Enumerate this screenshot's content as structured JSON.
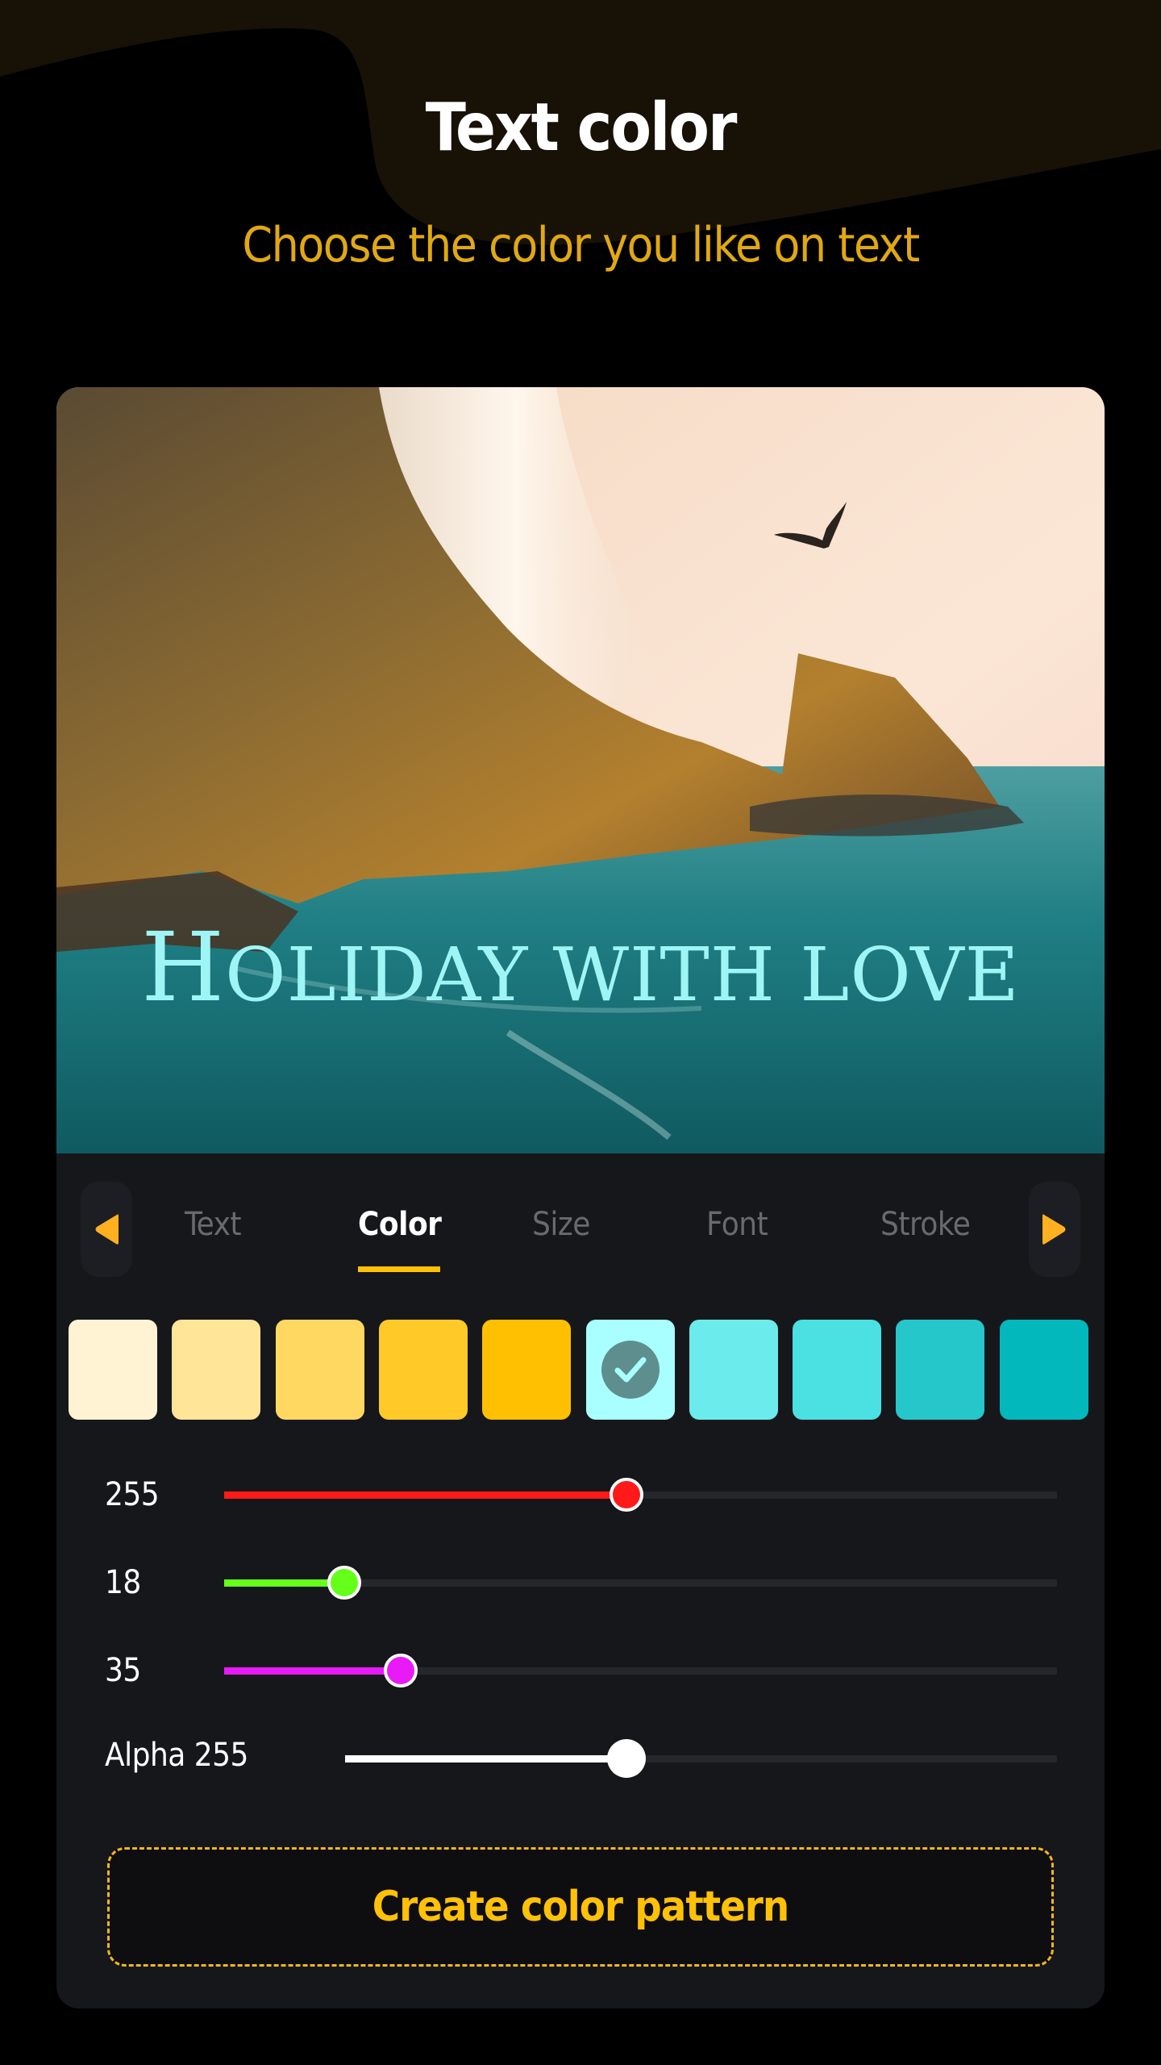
{
  "header": {
    "title": "Text color",
    "subtitle": "Choose the color you like on text"
  },
  "preview": {
    "overlay_text_first": "H",
    "overlay_text_rest": "OLIDAY WITH LOVE",
    "overlay_text_color": "#9FF5F5",
    "image_description": "cliff with waterfall, seagull and turquoise sea"
  },
  "tabs": {
    "prev_icon": "triangle-left-icon",
    "next_icon": "triangle-right-icon",
    "items": [
      {
        "label": "Text",
        "active": false
      },
      {
        "label": "Color",
        "active": true
      },
      {
        "label": "Size",
        "active": false
      },
      {
        "label": "Font",
        "active": false
      },
      {
        "label": "Stroke",
        "active": false
      }
    ]
  },
  "swatches": [
    {
      "color": "#FFF3D3",
      "selected": false
    },
    {
      "color": "#FFE597",
      "selected": false
    },
    {
      "color": "#FFD862",
      "selected": false
    },
    {
      "color": "#FFCA28",
      "selected": false
    },
    {
      "color": "#FFC002",
      "selected": false
    },
    {
      "color": "#A9FFFF",
      "selected": true
    },
    {
      "color": "#6BEBEB",
      "selected": false
    },
    {
      "color": "#4BE0E2",
      "selected": false
    },
    {
      "color": "#25C7CB",
      "selected": false
    },
    {
      "color": "#02B8BD",
      "selected": false
    }
  ],
  "sliders": [
    {
      "name": "red",
      "label": "255",
      "value_fraction": 0.483,
      "color": "#FF1A1A"
    },
    {
      "name": "green",
      "label": "18",
      "value_fraction": 0.144,
      "color": "#66FF1A"
    },
    {
      "name": "blue",
      "label": "35",
      "value_fraction": 0.212,
      "color": "#E81AF7"
    },
    {
      "name": "alpha",
      "label": "Alpha 255",
      "value_fraction": 0.395,
      "color": "#FFFFFF"
    }
  ],
  "actions": {
    "create_pattern_label": "Create color pattern"
  },
  "colors": {
    "accent": "#FFC107",
    "background": "#000000",
    "header_shape": "#171106",
    "card": "#16171B"
  }
}
